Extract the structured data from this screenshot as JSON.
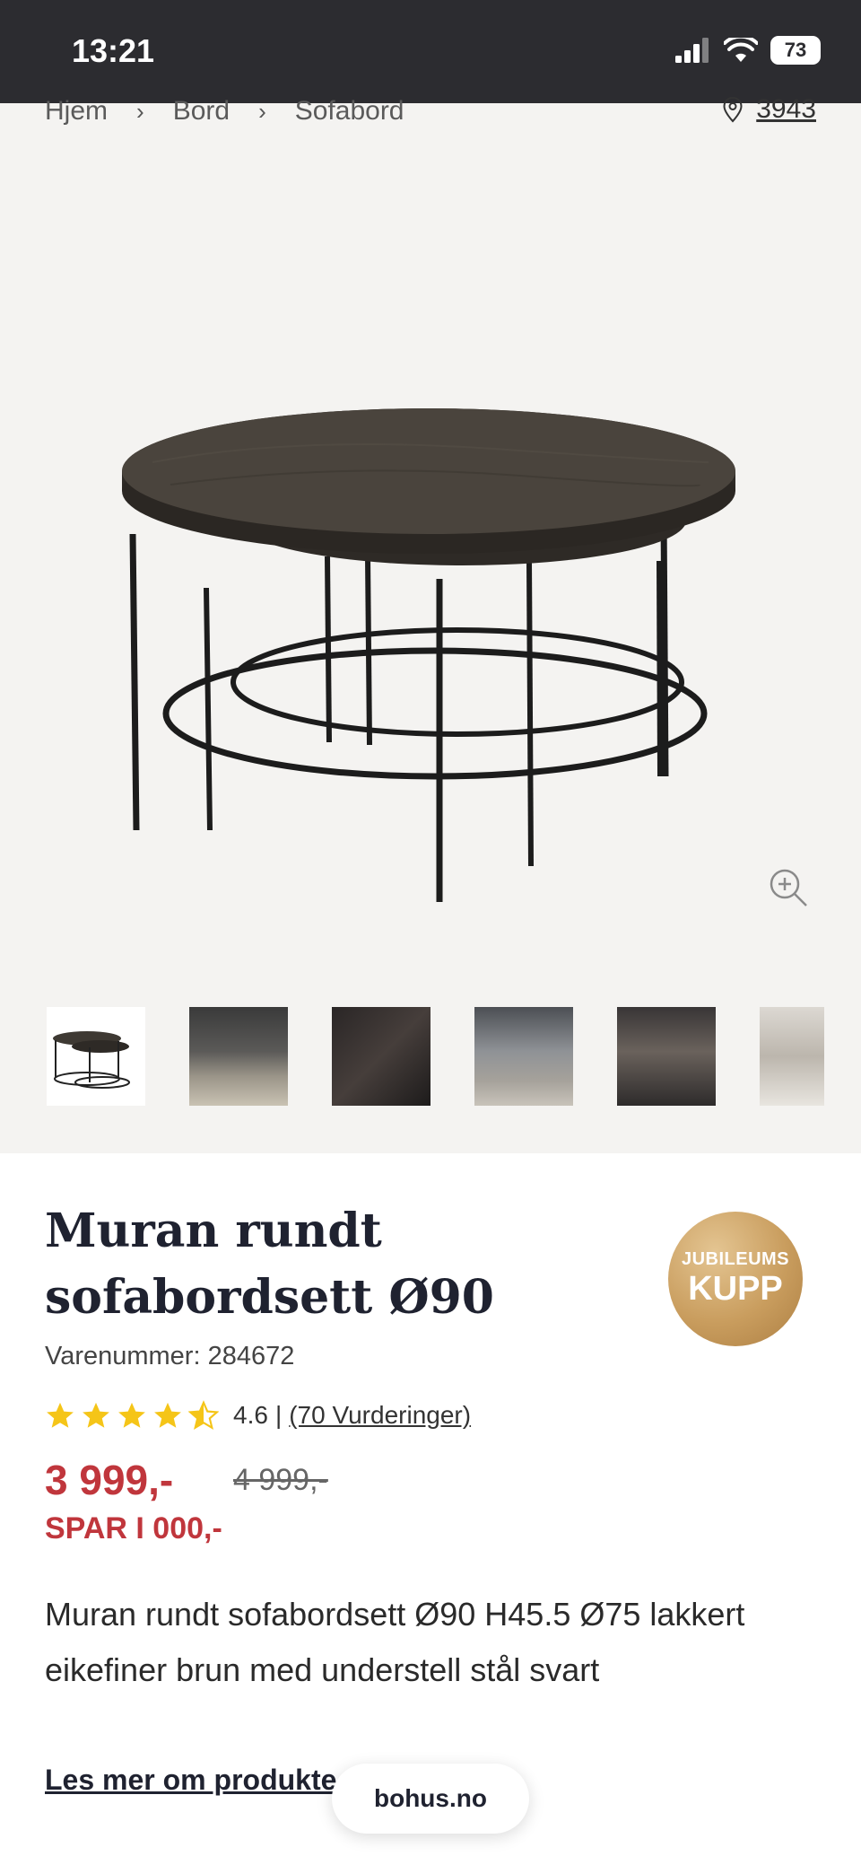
{
  "status_bar": {
    "time": "13:21",
    "battery": "73"
  },
  "breadcrumb": {
    "items": [
      "Hjem",
      "Bord",
      "Sofabord"
    ]
  },
  "location": {
    "code": "3943"
  },
  "product": {
    "title": "Muran rundt sofabordsett Ø90",
    "sku": "Varenummer: 284672",
    "badge": {
      "line1": "JUBILEUMS",
      "line2": "KUPP"
    },
    "rating": {
      "value": "4.6",
      "separator": "|",
      "count": "(70 Vurderinger)",
      "stars": 4.5
    },
    "price": "3 999,-",
    "old_price": "4 999,-",
    "save": "SPAR I 000,-",
    "description": "Muran rundt sofabordsett Ø90 H45.5 Ø75 lakkert eikefiner brun med understell stål svart",
    "read_more": "Les mer om produkte"
  },
  "thumbnails": [
    "thumbnail-1",
    "thumbnail-2",
    "thumbnail-3",
    "thumbnail-4",
    "thumbnail-5",
    "thumbnail-6"
  ],
  "browser": {
    "url": "bohus.no"
  },
  "colors": {
    "price_red": "#c0363c",
    "hero_bg": "#f4f3f1",
    "status_bg": "#2c2c30",
    "badge_gold": "#c99d5e",
    "star_yellow": "#f5c518"
  }
}
